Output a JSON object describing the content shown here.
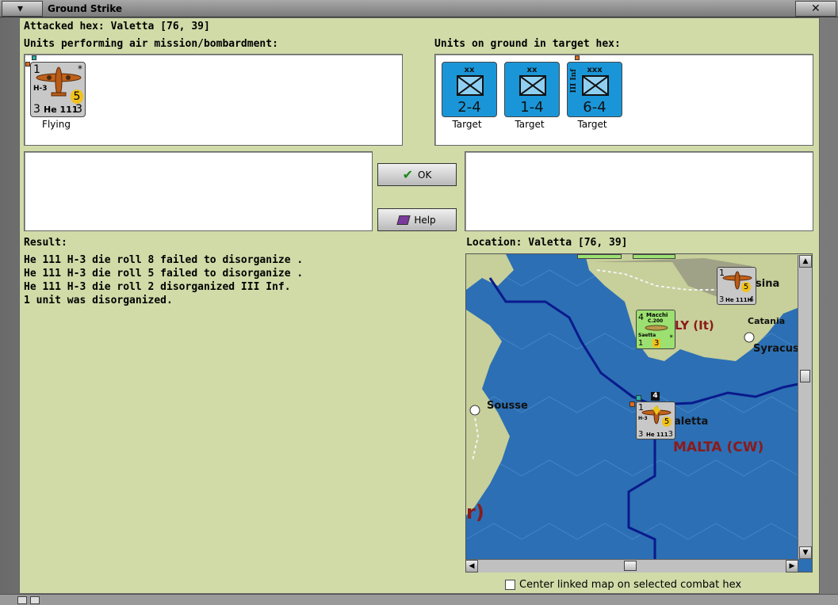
{
  "window": {
    "title": "Ground Strike"
  },
  "header": {
    "attacked_hex": "Attacked hex: Valetta  [76, 39]"
  },
  "air_panel": {
    "label": "Units performing air mission/bombardment:",
    "units": [
      {
        "top_left": "1",
        "model": "H-3",
        "range": "5",
        "bottom_left": "3",
        "name": "He 111",
        "bottom_right": "3",
        "star": "*",
        "status": "Flying"
      }
    ]
  },
  "ground_panel": {
    "label": "Units on ground in target hex:",
    "units": [
      {
        "size": "xx",
        "strength": "2-4",
        "side_label": "",
        "status": "Target"
      },
      {
        "size": "xx",
        "strength": "1-4",
        "side_label": "",
        "status": "Target"
      },
      {
        "size": "xxx",
        "strength": "6-4",
        "side_label": "III Inf",
        "status": "Target"
      }
    ]
  },
  "buttons": {
    "ok": "OK",
    "help": "Help"
  },
  "result": {
    "label": "Result:",
    "lines": [
      "He 111 H-3 die roll 8 failed to disorganize .",
      "He 111 H-3 die roll 5 failed to disorganize .",
      "He 111 H-3 die roll 2 disorganized III Inf.",
      "1 unit was disorganized."
    ]
  },
  "location": {
    "label": "Location:  Valetta  [76, 39]"
  },
  "map": {
    "labels": {
      "messina": "sina",
      "italy": "LY (It)",
      "catania": "Catania",
      "syracuse": "Syracus",
      "sousse": "Sousse",
      "valetta": "aletta",
      "malta": "MALTA (CW)",
      "partial": "r)"
    },
    "counters": {
      "messina_air": {
        "top_left": "1",
        "range": "5",
        "bottom_left": "3",
        "name": "He 111H",
        "bottom_right": "4"
      },
      "italian_air": {
        "top_left": "4",
        "name": "Macchi",
        "model": "C.200",
        "sub": "Saetta",
        "bottom_left": "1",
        "bottom_mid": "3",
        "star": "*"
      },
      "valetta_air": {
        "top_left": "1",
        "model": "H-3",
        "range": "5",
        "bottom_left": "3",
        "name": "He 111",
        "bottom_right": "3",
        "stack": "4"
      }
    },
    "colors": {
      "sea": "#2c6fb4",
      "land": "#c7cf9a",
      "border": "#0a1a8c",
      "label_red": "#8b1a1a"
    }
  },
  "options": {
    "center_linked": "Center linked map on selected combat hex"
  }
}
